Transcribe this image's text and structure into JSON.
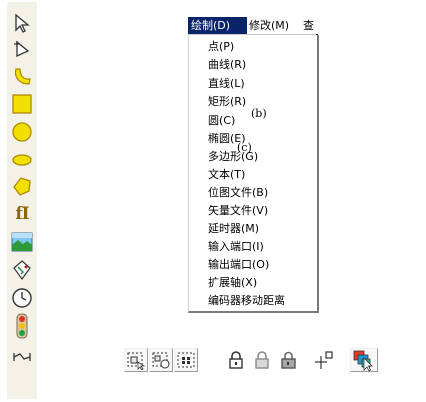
{
  "menubar": {
    "items": [
      "绘制(D)",
      "修改(M)",
      "查"
    ],
    "active_index": 0
  },
  "draw_menu": {
    "items": [
      "点(P)",
      "曲线(R)",
      "直线(L)",
      "矩形(R)",
      "圆(C)",
      "椭圆(E)",
      "多边形(G)",
      "文本(T)",
      "位图文件(B)",
      "矢量文件(V)",
      "延时器(M)",
      "输入端口(I)",
      "输出端口(O)",
      "扩展轴(X)",
      "编码器移动距离"
    ]
  },
  "annotations": {
    "b": "(b)",
    "c": "(c)"
  },
  "left_toolbar": {
    "tools": [
      "select-arrow-icon",
      "point-arrow-icon",
      "curve-icon",
      "rectangle-icon",
      "circle-icon",
      "ellipse-icon",
      "polygon-icon",
      "text-icon",
      "bitmap-icon",
      "vector-file-icon",
      "timer-icon",
      "io-port-icon",
      "axis-icon"
    ],
    "text_tool_glyph": "fI"
  },
  "bottom_toolbar": {
    "tools": [
      "group-icon",
      "ungroup-icon",
      "select-all-icon",
      "lock-icon",
      "unlock-icon",
      "lock-all-icon",
      "origin-icon",
      "color-icon"
    ]
  },
  "colors": {
    "menu_highlight": "#0a246a",
    "shape_yellow": "#f2e100",
    "shape_outline": "#b08800"
  }
}
